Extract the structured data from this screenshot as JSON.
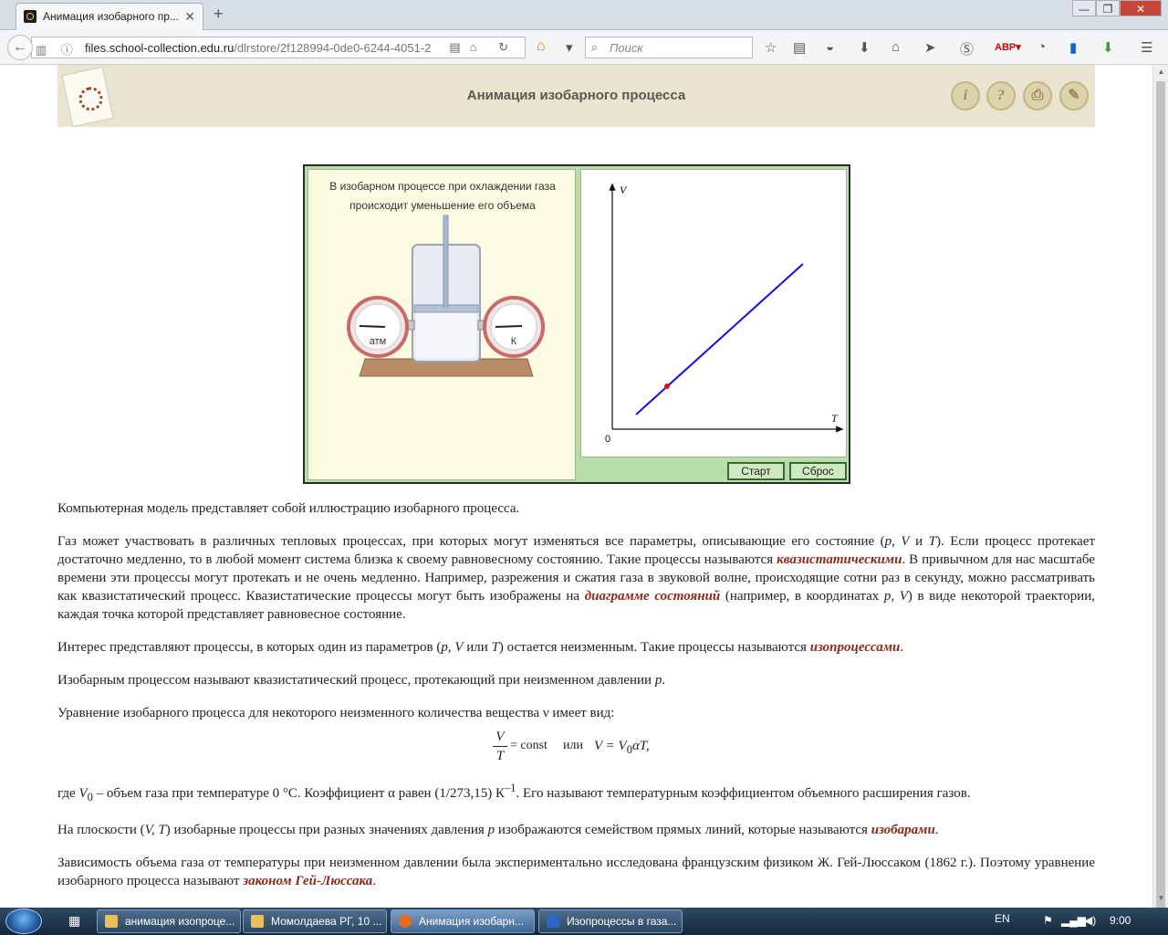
{
  "browser": {
    "tab_title": "Анимация изобарного пр...",
    "tab_close": "✕",
    "new_tab": "+",
    "window_min": "—",
    "window_max": "❐",
    "window_close": "✕",
    "url_host": "files.school-collection.edu.ru",
    "url_path": "/dlrstore/2f128994-0de0-6244-4051-2",
    "search_placeholder": "Поиск"
  },
  "header": {
    "title": "Анимация изобарного процесса",
    "info_btn": "i",
    "help_btn": "?",
    "print_btn": "⎙",
    "book_btn": "✎"
  },
  "animation": {
    "caption_line1": "В изобарном процессе при охлаждении газа",
    "caption_line2": "происходит уменьшение его объема",
    "gauge_left_label": "атм",
    "gauge_right_label": "К",
    "graph_y_label": "V",
    "graph_x_label": "T",
    "graph_origin": "0",
    "start_button": "Старт",
    "reset_button": "Сброс"
  },
  "article": {
    "p1": "Компьютерная модель представляет собой иллюстрацию изобарного процесса.",
    "p2_a": "Газ может участвовать в различных тепловых процессах, при которых могут изменяться все параметры, описывающие его состояние (",
    "p2_vars": "p, V",
    "p2_and": " и ",
    "p2_T": "T",
    "p2_b": "). Если процесс протекает достаточно медленно, то в любой момент система близка к своему равновесному состоянию. Такие процессы называются ",
    "p2_term1": "квазистатическими",
    "p2_c": ". В привычном для нас масштабе времени эти процессы могут протекать и не очень медленно. Например, разрежения и сжатия газа в звуковой волне, происходящие сотни раз в секунду, можно рассматривать как квазистатический процесс. Квазистатические процессы могут быть изображены на ",
    "p2_term2": "диаграмме состояний",
    "p2_d": " (например, в координатах ",
    "p2_coords": "p, V",
    "p2_e": ") в виде некоторой траектории, каждая точка которой представляет равновесное состояние.",
    "p3_a": "Интерес представляют процессы, в которых один из параметров (",
    "p3_vars": "p, V",
    "p3_or": " или ",
    "p3_T": "T",
    "p3_b": ") остается неизменным. Такие процессы называются ",
    "p3_term": "изопроцессами",
    "p3_c": ".",
    "p4_a": "Изобарным процессом называют квазистатический процесс, протекающий при неизменном давлении ",
    "p4_p": "p",
    "p4_b": ".",
    "p5": "Уравнение изобарного процесса для некоторого неизменного количества вещества ν имеет вид:",
    "formula_num": "V",
    "formula_den": "T",
    "formula_const": "= const",
    "formula_or": "или",
    "formula_rhs_a": "V = V",
    "formula_rhs_sub": "0",
    "formula_rhs_b": "αT,",
    "p6_a": "где ",
    "p6_V": "V",
    "p6_sub": "0",
    "p6_b": " – объем газа при температуре 0 °С. Коэффициент α равен (1/273,15) К",
    "p6_sup": "–1",
    "p6_c": ". Его называют температурным коэффициентом объемного расширения газов.",
    "p7_a": "На плоскости (",
    "p7_vars": "V, T",
    "p7_b": ") изобарные процессы при разных значениях давления ",
    "p7_p": "p",
    "p7_c": " изображаются семейством прямых линий, которые называются ",
    "p7_term": "изобарами",
    "p7_d": ".",
    "p8_a": "Зависимость объема газа от температуры при неизменном давлении была экспериментально исследована французским физиком Ж. Гей-Люссаком (1862 г.). Поэтому уравнение изобарного процесса называют ",
    "p8_term": "законом Гей-Люссака",
    "p8_b": "."
  },
  "taskbar": {
    "tasks": [
      "анимация изопроце...",
      "Момолдаева РГ, 10 ...",
      "Анимация изобарн...",
      "Изопроцессы в газа..."
    ],
    "lang": "EN",
    "time": "9:00"
  },
  "colors": {
    "graph_line": "#1010e0",
    "graph_point": "#e01010",
    "term_color": "#8a2a1a"
  }
}
